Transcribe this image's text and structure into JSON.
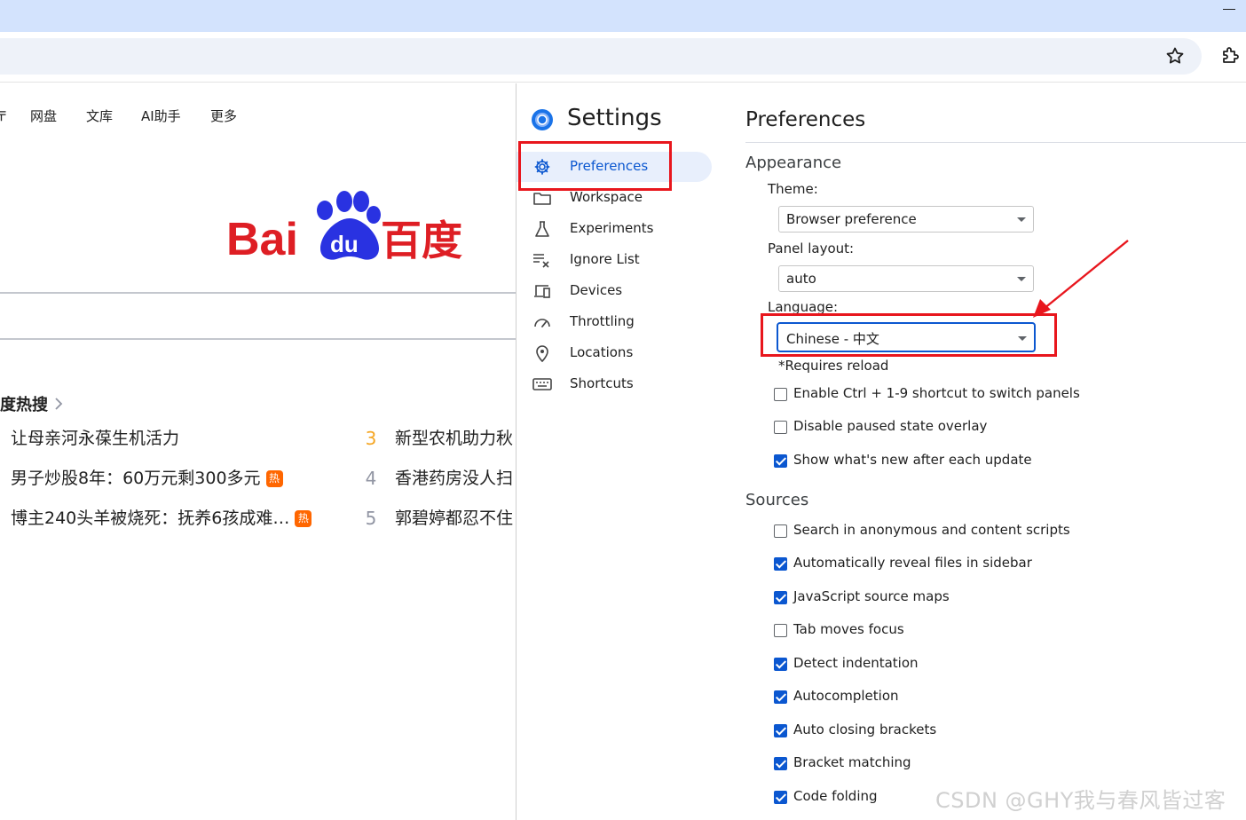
{
  "baidu": {
    "nav": [
      "网盘",
      "文库",
      "AI助手",
      "更多"
    ],
    "logo_alt": "Baidu百度",
    "hot_title": "度热搜",
    "hot_items": [
      {
        "rank": "",
        "text": "让母亲河永葆生机活力",
        "badge": ""
      },
      {
        "rank": "3",
        "text": "新型农机助力秋",
        "badge": ""
      },
      {
        "rank": "",
        "text": "男子炒股8年：60万元剩300多元",
        "badge": "热"
      },
      {
        "rank": "4",
        "text": "香港药房没人扫",
        "badge": ""
      },
      {
        "rank": "",
        "text": "博主240头羊被烧死：抚养6孩成难…",
        "badge": "热"
      },
      {
        "rank": "5",
        "text": "郭碧婷都忍不住",
        "badge": ""
      }
    ],
    "rank_colors": {
      "3": "#f5a623",
      "4": "#9195a3",
      "5": "#9195a3"
    }
  },
  "settings": {
    "title": "Settings",
    "sidebar": [
      {
        "label": "Preferences",
        "icon": "gear-icon",
        "selected": true
      },
      {
        "label": "Workspace",
        "icon": "folder-icon",
        "selected": false
      },
      {
        "label": "Experiments",
        "icon": "flask-icon",
        "selected": false
      },
      {
        "label": "Ignore List",
        "icon": "ignore-list-icon",
        "selected": false
      },
      {
        "label": "Devices",
        "icon": "devices-icon",
        "selected": false
      },
      {
        "label": "Throttling",
        "icon": "gauge-icon",
        "selected": false
      },
      {
        "label": "Locations",
        "icon": "location-pin-icon",
        "selected": false
      },
      {
        "label": "Shortcuts",
        "icon": "keyboard-icon",
        "selected": false
      }
    ],
    "preferences": {
      "title": "Preferences",
      "appearance": {
        "heading": "Appearance",
        "theme_label": "Theme:",
        "theme_value": "Browser preference",
        "panel_layout_label": "Panel layout:",
        "panel_layout_value": "auto",
        "language_label": "Language:",
        "language_value": "Chinese - 中文",
        "requires_reload": "*Requires reload",
        "checkboxes": [
          {
            "label": "Enable Ctrl + 1-9 shortcut to switch panels",
            "checked": false
          },
          {
            "label": "Disable paused state overlay",
            "checked": false
          },
          {
            "label": "Show what's new after each update",
            "checked": true
          }
        ]
      },
      "sources": {
        "heading": "Sources",
        "checkboxes": [
          {
            "label": "Search in anonymous and content scripts",
            "checked": false
          },
          {
            "label": "Automatically reveal files in sidebar",
            "checked": true
          },
          {
            "label": "JavaScript source maps",
            "checked": true
          },
          {
            "label": "Tab moves focus",
            "checked": false
          },
          {
            "label": "Detect indentation",
            "checked": true
          },
          {
            "label": "Autocompletion",
            "checked": true
          },
          {
            "label": "Auto closing brackets",
            "checked": true
          },
          {
            "label": "Bracket matching",
            "checked": true
          },
          {
            "label": "Code folding",
            "checked": true
          }
        ]
      }
    }
  },
  "watermark": "CSDN @GHY我与春风皆过客",
  "colors": {
    "accent": "#0b57d0",
    "highlight": "#e8161d",
    "baidu_red": "#de1e24",
    "baidu_blue": "#2932e1"
  }
}
